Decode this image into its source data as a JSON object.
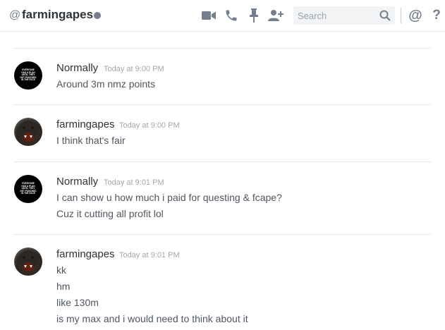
{
  "header": {
    "at_symbol": "@",
    "channel_name": "farmingapes",
    "status_color": "#747f8d",
    "icons": [
      "video-call-icon",
      "voice-call-icon",
      "pin-icon",
      "add-member-icon",
      "search-icon",
      "mention-icon",
      "help-icon"
    ],
    "search_placeholder": "Search",
    "mention_label": "@",
    "help_label": "?"
  },
  "messages": [
    {
      "author": "Normally",
      "timestamp": "Today at 9:00 PM",
      "avatar": "black-text-avatar",
      "lines": [
        "Around 3m nmz points"
      ]
    },
    {
      "author": "farmingapes",
      "timestamp": "Today at 9:00 PM",
      "avatar": "ape-avatar",
      "lines": [
        "I think that's fair"
      ]
    },
    {
      "author": "Normally",
      "timestamp": "Today at 9:01 PM",
      "avatar": "black-text-avatar",
      "lines": [
        "I can show u how much i paid for questing & fcape?",
        "Cuz it cutting all profit lol"
      ]
    },
    {
      "author": "farmingapes",
      "timestamp": "Today at 9:01 PM",
      "avatar": "ape-avatar",
      "lines": [
        "kk",
        "hm",
        "like 130m",
        "is my max and i would need to think about it"
      ]
    }
  ],
  "colors": {
    "author": "#2e3338",
    "text": "#4f5660",
    "timestamp": "#a3a6aa",
    "icon": "#747f8d"
  }
}
